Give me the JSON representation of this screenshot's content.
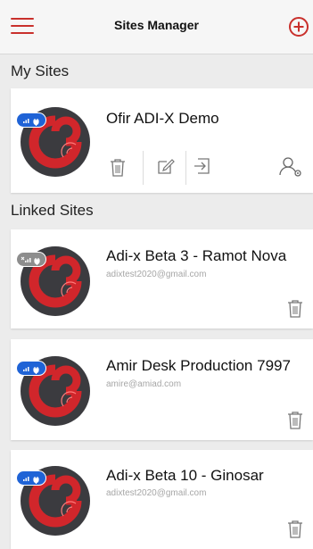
{
  "header": {
    "title": "Sites Manager",
    "menu_icon": "hamburger-menu-icon",
    "add_icon": "add-circle-icon",
    "accent_color": "#c9302c"
  },
  "my_sites": {
    "title": "My Sites",
    "sites": [
      {
        "name": "Ofir ADI-X Demo",
        "status": "online",
        "actions": [
          "trash-icon",
          "edit-icon",
          "login-icon",
          "user-settings-icon"
        ]
      }
    ]
  },
  "linked_sites": {
    "title": "Linked Sites",
    "sites": [
      {
        "name": "Adi-x Beta 3 - Ramot Nova",
        "email": "adixtest2020@gmail.com",
        "status": "offline"
      },
      {
        "name": "Amir Desk Production 7997",
        "email": "amire@amiad.com",
        "status": "online"
      },
      {
        "name": "Adi-x Beta 10 - Ginosar",
        "email": "adixtest2020@gmail.com",
        "status": "online"
      }
    ]
  },
  "colors": {
    "status_online": "#1f63d6",
    "status_offline": "#8d8d8d",
    "logo_bg": "#3b3b3f",
    "logo_red": "#d1262b"
  }
}
